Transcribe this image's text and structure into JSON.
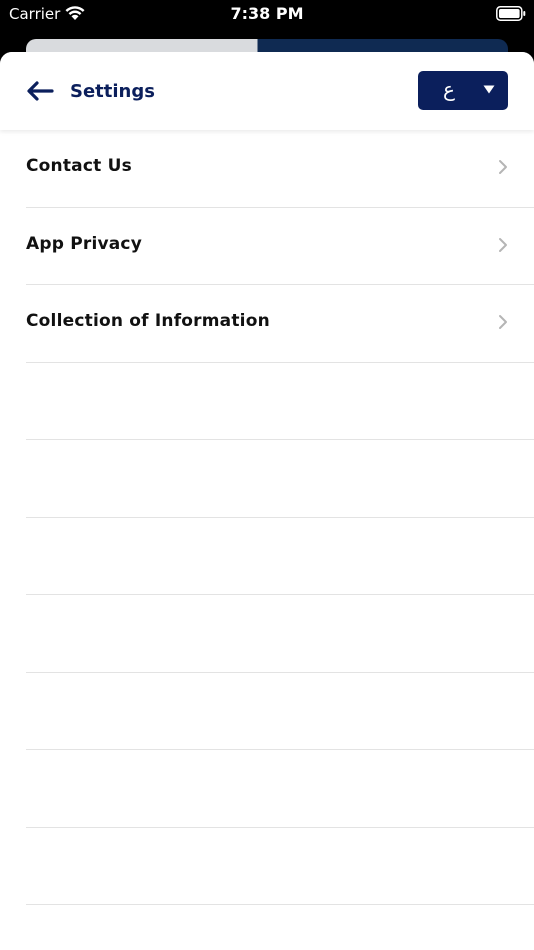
{
  "status": {
    "carrier": "Carrier",
    "time": "7:38 PM"
  },
  "nav": {
    "title": "Settings",
    "language_label": "ع"
  },
  "menu": {
    "items": [
      {
        "label": "Contact Us",
        "icon": "chevron-right-icon"
      },
      {
        "label": "App Privacy",
        "icon": "chevron-right-icon"
      },
      {
        "label": "Collection of Information",
        "icon": "chevron-right-icon"
      }
    ]
  },
  "colors": {
    "primary": "#0b1f5c",
    "divider": "#e3e3e3",
    "chevron": "#b5b5b5"
  }
}
